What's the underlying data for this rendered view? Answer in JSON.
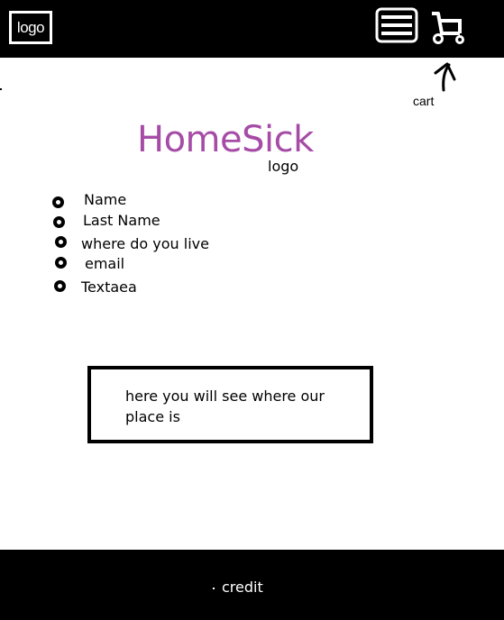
{
  "header": {
    "logo_label": "logo",
    "menu_icon": "hamburger-menu-icon",
    "cart_icon": "cart-icon"
  },
  "annotation": {
    "cart_label": "cart"
  },
  "brand": {
    "title": "HomeSick",
    "subtitle": "logo",
    "color": "#a64ca6"
  },
  "form": {
    "fields": [
      {
        "label": "Name"
      },
      {
        "label": "Last Name"
      },
      {
        "label": "where do you live"
      },
      {
        "label": "email"
      },
      {
        "label": "Textaea"
      }
    ]
  },
  "map": {
    "text": "here you will see where our place is"
  },
  "footer": {
    "credit": "credit"
  }
}
